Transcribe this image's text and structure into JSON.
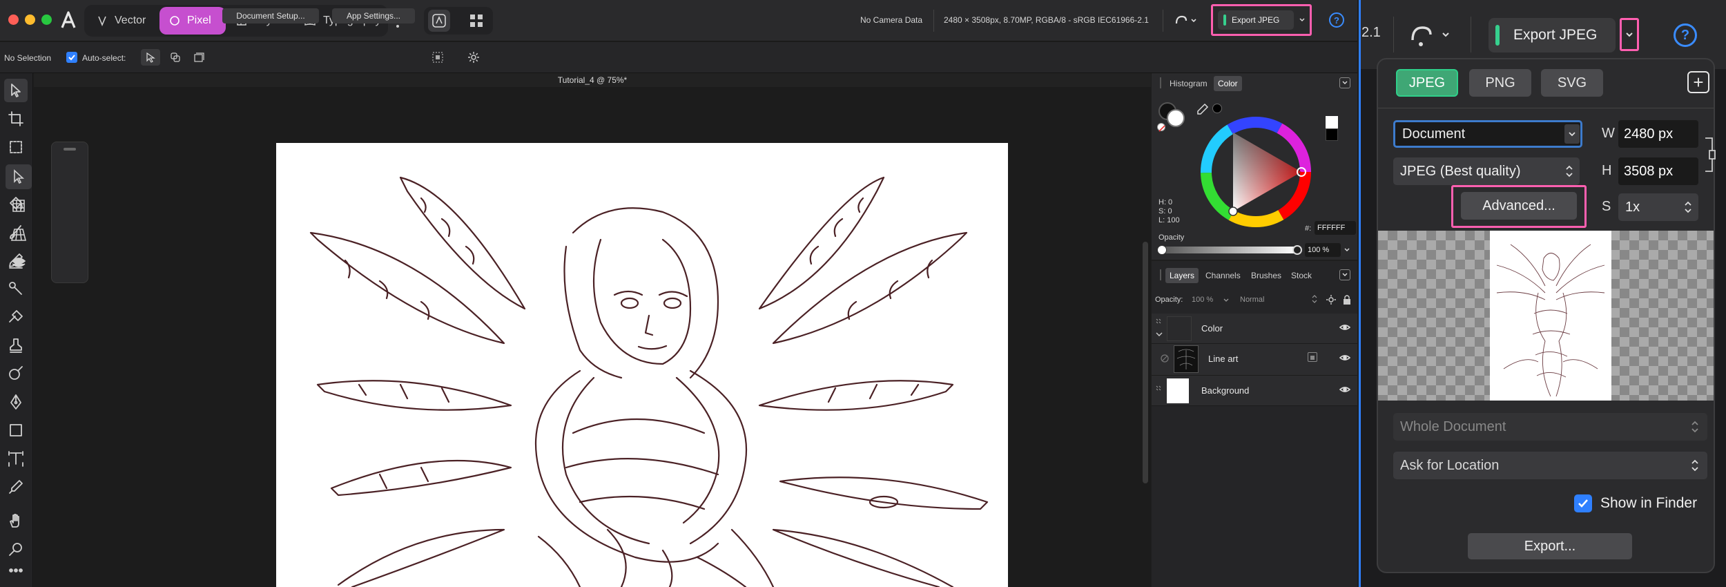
{
  "app": {
    "personas": [
      "Vector",
      "Pixel",
      "Layout",
      "Typography"
    ],
    "active_persona": "Pixel",
    "camera_info": "No Camera Data",
    "doc_info": "2480 × 3508px, 8.70MP, RGBA/8 - sRGB IEC61966-2.1",
    "export_label": "Export JPEG",
    "help_glyph": "?"
  },
  "context_bar": {
    "selection": "No Selection",
    "auto_select": "Auto-select:",
    "document_setup": "Document Setup...",
    "app_settings": "App Settings..."
  },
  "canvas": {
    "title": "Tutorial_4 @ 75%*"
  },
  "color_panel": {
    "tabs": [
      "Histogram",
      "Color"
    ],
    "active_tab": "Color",
    "h": "H: 0",
    "s": "S: 0",
    "l": "L: 100",
    "hex_label": "#:",
    "hex_value": "FFFFFF",
    "opacity_label": "Opacity",
    "opacity_value": "100 %"
  },
  "layers_panel": {
    "tabs": [
      "Layers",
      "Channels",
      "Brushes",
      "Stock"
    ],
    "active_tab": "Layers",
    "opacity_label": "Opacity:",
    "opacity_value": "100 %",
    "blend_mode": "Normal",
    "layers": [
      {
        "name": "Color"
      },
      {
        "name": "Line art"
      },
      {
        "name": "Background"
      }
    ]
  },
  "zoom_header": {
    "version_fragment": "2.1",
    "export_label": "Export JPEG",
    "help_glyph": "?"
  },
  "export_popup": {
    "formats": [
      "JPEG",
      "PNG",
      "SVG"
    ],
    "active_format": "JPEG",
    "add_glyph": "+",
    "area": "Document",
    "quality": "JPEG (Best quality)",
    "advanced": "Advanced...",
    "w_label": "W",
    "w_value": "2480 px",
    "h_label": "H",
    "h_value": "3508 px",
    "s_label": "S",
    "s_value": "1x",
    "scope": "Whole Document",
    "location": "Ask for Location",
    "show_in_finder": "Show in Finder",
    "show_in_finder_checked": true,
    "export_button": "Export..."
  },
  "colors": {
    "accent_pixel": "#c64fcf",
    "highlight": "#ff5fb0",
    "jpeg_green": "#3fa775",
    "checkbox_blue": "#2f80ff"
  }
}
